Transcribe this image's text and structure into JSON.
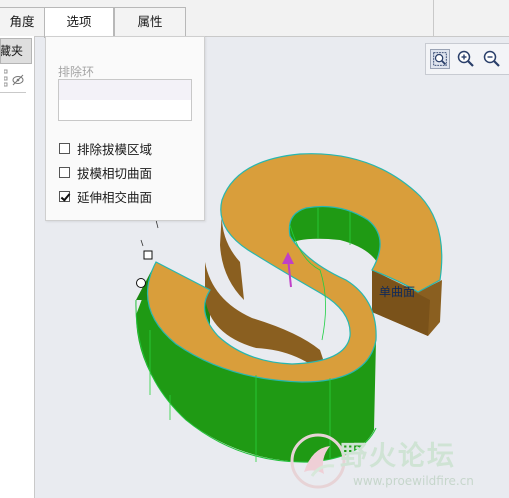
{
  "tabs": [
    {
      "label": "角度"
    },
    {
      "label": "选项"
    },
    {
      "label": "属性"
    }
  ],
  "left_panel": {
    "header_fragment": "藏夹"
  },
  "options_panel": {
    "exclude_loops_label": "排除环",
    "checkboxes": [
      {
        "label": "排除拔模区域",
        "checked": false
      },
      {
        "label": "拔模相切曲面",
        "checked": false
      },
      {
        "label": "延伸相交曲面",
        "checked": true
      }
    ]
  },
  "view_tools": [
    {
      "icon": "zoom-window-icon"
    },
    {
      "icon": "zoom-in-icon"
    },
    {
      "icon": "zoom-out-icon"
    }
  ],
  "model": {
    "callout_label": "单曲面",
    "top_color": "#d99e3b",
    "wall_dark_color": "#8a5f20",
    "draft_color": "#1f9a14",
    "edge_color": "#27b7b0",
    "arrow_color": "#c040c8",
    "tick_marks": [
      "7",
      "0"
    ]
  },
  "watermark": {
    "text": "野火论坛",
    "url": "www.proewildfire.cn"
  }
}
